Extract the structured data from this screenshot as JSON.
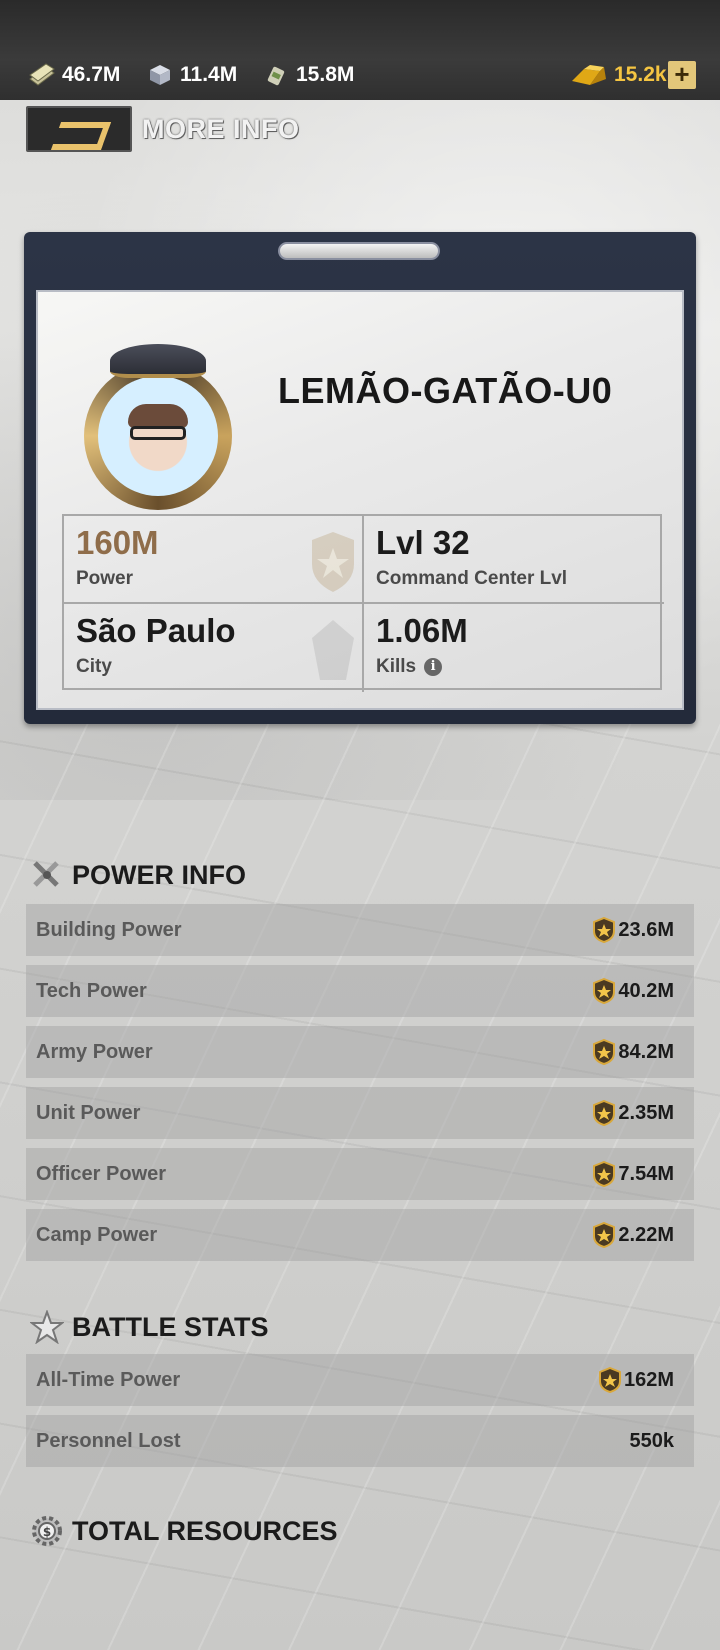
{
  "resources": [
    {
      "icon": "cash-stack-icon",
      "value": "46.7M"
    },
    {
      "icon": "iron-cube-icon",
      "value": "11.4M"
    },
    {
      "icon": "oil-can-icon",
      "value": "15.8M"
    }
  ],
  "gold": {
    "icon": "gold-bars-icon",
    "value": "15.2k",
    "add_label": "+"
  },
  "more_info": {
    "label": "MORE INFO"
  },
  "profile": {
    "name": "LEMÃO-GATÃO-U0",
    "power_value": "160M",
    "power_label": "Power",
    "level_value": "Lvl 32",
    "level_label": "Command Center Lvl",
    "city_value": "São Paulo",
    "city_label": "City",
    "kills_value": "1.06M",
    "kills_label": "Kills",
    "kills_info": "i"
  },
  "power_info": {
    "title": "POWER INFO",
    "rows": [
      {
        "label": "Building Power",
        "value": "23.6M"
      },
      {
        "label": "Tech Power",
        "value": "40.2M"
      },
      {
        "label": "Army Power",
        "value": "84.2M"
      },
      {
        "label": "Unit Power",
        "value": "2.35M"
      },
      {
        "label": "Officer Power",
        "value": "7.54M"
      },
      {
        "label": "Camp Power",
        "value": "2.22M"
      }
    ]
  },
  "battle_stats": {
    "title": "BATTLE STATS",
    "rows": [
      {
        "label": "All-Time Power",
        "value": "162M"
      },
      {
        "label": "Personnel Lost",
        "value": "550k"
      }
    ]
  },
  "total_resources": {
    "title": "TOTAL RESOURCES"
  },
  "colors": {
    "accent_gold": "#f5c542",
    "power_brown": "#8f6d4a",
    "card_navy": "#2c3446"
  }
}
